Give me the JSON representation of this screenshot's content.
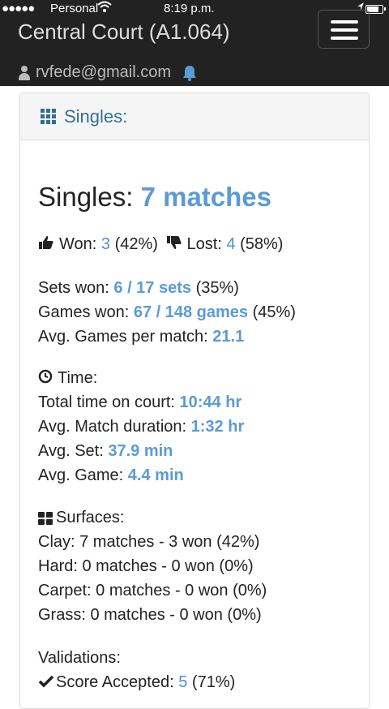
{
  "status_bar": {
    "dots": "●●●●●",
    "carrier": "Personal",
    "time": "8:19 p.m."
  },
  "header": {
    "title": "Central Court (A1.064)",
    "user_email": "rvfede@gmail.com"
  },
  "panel": {
    "heading": "Singles:"
  },
  "summary": {
    "title_prefix": "Singles:",
    "title_value": "7 matches",
    "won_label": "Won:",
    "won_value": "3",
    "won_pct": "(42%)",
    "lost_label": "Lost:",
    "lost_value": "4",
    "lost_pct": "(58%)"
  },
  "sets": {
    "sets_label": "Sets won:",
    "sets_value": "6 / 17 sets",
    "sets_pct": "(35%)",
    "games_label": "Games won:",
    "games_value": "67 / 148 games",
    "games_pct": "(45%)",
    "avg_games_label": "Avg. Games per match:",
    "avg_games_value": "21.1"
  },
  "time": {
    "heading": "Time:",
    "total_label": "Total time on court:",
    "total_value": "10:44 hr",
    "avg_match_label": "Avg. Match duration:",
    "avg_match_value": "1:32 hr",
    "avg_set_label": "Avg. Set:",
    "avg_set_value": "37.9 min",
    "avg_game_label": "Avg. Game:",
    "avg_game_value": "4.4 min"
  },
  "surfaces": {
    "heading": "Surfaces:",
    "items": [
      "Clay: 7 matches - 3 won (42%)",
      "Hard: 0 matches - 0 won (0%)",
      "Carpet: 0 matches - 0 won (0%)",
      "Grass: 0 matches - 0 won (0%)"
    ]
  },
  "validations": {
    "heading": "Validations:",
    "accepted_label": "Score Accepted:",
    "accepted_value": "5",
    "accepted_pct": "(71%)"
  },
  "colors": {
    "accent_blue": "#5b9bd5",
    "panel_heading": "#31708f",
    "topbar": "#222222"
  },
  "icons": [
    "wifi-icon",
    "location-arrow-icon",
    "battery-icon",
    "menu-icon",
    "user-icon",
    "bell-icon",
    "th-icon",
    "thumbs-up-icon",
    "thumbs-down-icon",
    "clock-icon",
    "th-large-icon",
    "check-icon"
  ]
}
